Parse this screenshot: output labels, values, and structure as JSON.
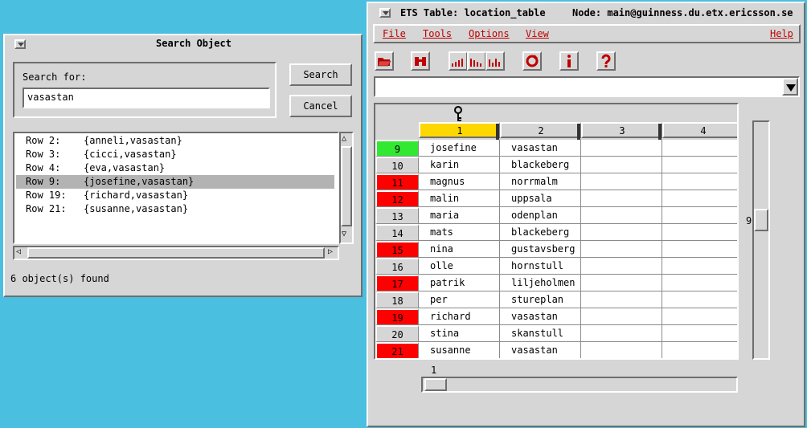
{
  "search_window": {
    "title": "Search Object",
    "search_label": "Search for:",
    "search_value": "vasastan",
    "search_button": "Search",
    "cancel_button": "Cancel",
    "results": [
      {
        "row": "Row 2:",
        "value": "{anneli,vasastan}"
      },
      {
        "row": "Row 3:",
        "value": "{cicci,vasastan}"
      },
      {
        "row": "Row 4:",
        "value": "{eva,vasastan}"
      },
      {
        "row": "Row 9:",
        "value": "{josefine,vasastan}"
      },
      {
        "row": "Row 19:",
        "value": "{richard,vasastan}"
      },
      {
        "row": "Row 21:",
        "value": "{susanne,vasastan}"
      }
    ],
    "selected_result": 3,
    "status": "6 object(s) found"
  },
  "table_window": {
    "title": "ETS Table:  location_table",
    "node": "Node: main@guinness.du.etx.ericsson.se",
    "menu": {
      "file": "File",
      "tools": "Tools",
      "options": "Options",
      "view": "View",
      "help": "Help"
    },
    "toolbar_icons": [
      "open-folder-icon",
      "binoculars-icon",
      "sort-ascending-icon",
      "sort-descending-icon",
      "sort-none-icon",
      "refresh-icon",
      "info-icon",
      "help-icon"
    ],
    "columns": [
      "1",
      "2",
      "3",
      "4"
    ],
    "key_column": "1",
    "rows": [
      {
        "n": "9",
        "c1": "josefine",
        "c2": "vasastan",
        "mark": "green"
      },
      {
        "n": "10",
        "c1": "karin",
        "c2": "blackeberg",
        "mark": "grey"
      },
      {
        "n": "11",
        "c1": "magnus",
        "c2": "norrmalm",
        "mark": "red"
      },
      {
        "n": "12",
        "c1": "malin",
        "c2": "uppsala",
        "mark": "red"
      },
      {
        "n": "13",
        "c1": "maria",
        "c2": "odenplan",
        "mark": "grey"
      },
      {
        "n": "14",
        "c1": "mats",
        "c2": "blackeberg",
        "mark": "grey"
      },
      {
        "n": "15",
        "c1": "nina",
        "c2": "gustavsberg",
        "mark": "red"
      },
      {
        "n": "16",
        "c1": "olle",
        "c2": "hornstull",
        "mark": "grey"
      },
      {
        "n": "17",
        "c1": "patrik",
        "c2": "liljeholmen",
        "mark": "red"
      },
      {
        "n": "18",
        "c1": "per",
        "c2": "stureplan",
        "mark": "grey"
      },
      {
        "n": "19",
        "c1": "richard",
        "c2": "vasastan",
        "mark": "red"
      },
      {
        "n": "20",
        "c1": "stina",
        "c2": "skanstull",
        "mark": "grey"
      },
      {
        "n": "21",
        "c1": "susanne",
        "c2": "vasastan",
        "mark": "red"
      }
    ],
    "vscroll_value": "9",
    "hscroll_value": "1"
  },
  "colors": {
    "desktop": "#4bbfe0",
    "window": "#d6d6d6",
    "red": "#ff0000",
    "green": "#33e833",
    "grey": "#d6d6d6",
    "key_column": "#ffd700",
    "menu_text": "#c00000"
  }
}
